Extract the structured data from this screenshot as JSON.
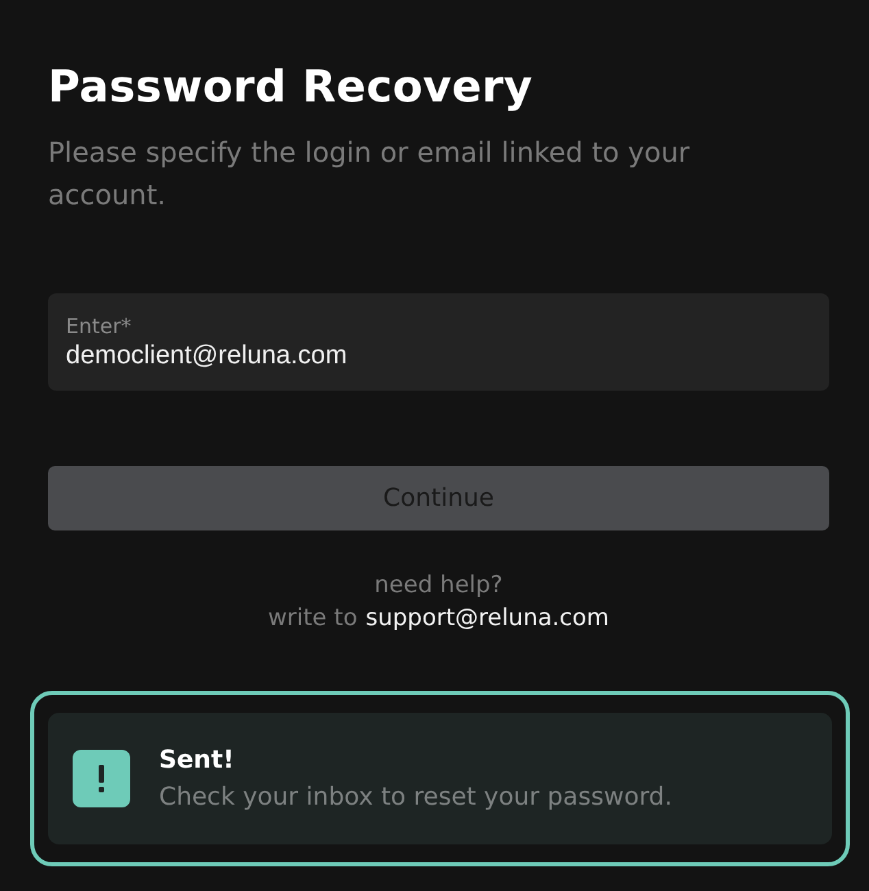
{
  "title": "Password Recovery",
  "subtitle": "Please specify the login or email linked to your account.",
  "field": {
    "label": "Enter*",
    "value": "democlient@reluna.com"
  },
  "button": {
    "label": "Continue",
    "disabled": true
  },
  "help": {
    "line_1": "need help?",
    "prefix": "write to",
    "link": "support@reluna.com"
  },
  "toast": {
    "kind": "success",
    "title": "Sent!",
    "message": "Check your inbox to reset your password."
  }
}
